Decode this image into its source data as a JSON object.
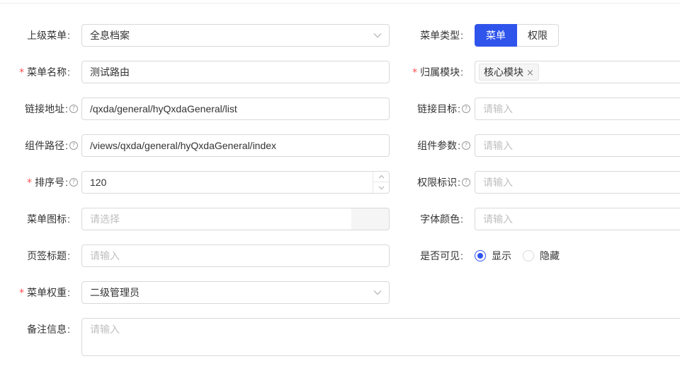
{
  "form": {
    "parent_menu": {
      "label": "上级菜单",
      "value": "全息档案",
      "chevron_icon": "chevron-down-icon"
    },
    "menu_type": {
      "label": "菜单类型",
      "options": [
        "菜单",
        "权限"
      ],
      "selected": "菜单",
      "accent": "#2f54eb"
    },
    "menu_name": {
      "label": "菜单名称",
      "required": true,
      "value": "测试路由"
    },
    "module": {
      "label": "归属模块",
      "required": true,
      "tags": [
        "核心模块"
      ],
      "remove_glyph": "×"
    },
    "link_url": {
      "label": "链接地址",
      "help_icon": "question-circle-icon",
      "value": "/qxda/general/hyQxdaGeneral/list"
    },
    "link_target": {
      "label": "链接目标",
      "help_icon": "question-circle-icon",
      "placeholder": "请输入"
    },
    "component_path": {
      "label": "组件路径",
      "help_icon": "question-circle-icon",
      "value": "/views/qxda/general/hyQxdaGeneral/index"
    },
    "component_params": {
      "label": "组件参数",
      "help_icon": "question-circle-icon",
      "placeholder": "请输入"
    },
    "sort_no": {
      "label": "排序号",
      "required": true,
      "help_icon": "question-circle-icon",
      "value": "120"
    },
    "permission_key": {
      "label": "权限标识",
      "help_icon": "question-circle-icon",
      "placeholder": "请输入"
    },
    "menu_icon": {
      "label": "菜单图标",
      "placeholder": "请选择"
    },
    "font_color": {
      "label": "字体颜色",
      "placeholder": "请输入"
    },
    "tab_title": {
      "label": "页签标题",
      "placeholder": "请输入"
    },
    "visible": {
      "label": "是否可见",
      "options": [
        "显示",
        "隐藏"
      ],
      "selected": "显示"
    },
    "menu_weight": {
      "label": "菜单权重",
      "required": true,
      "value": "二级管理员",
      "chevron_icon": "chevron-down-icon"
    },
    "remarks": {
      "label": "备注信息",
      "placeholder": "请输入"
    }
  },
  "colon": ":",
  "required_mark": "*",
  "help_glyph": "?"
}
